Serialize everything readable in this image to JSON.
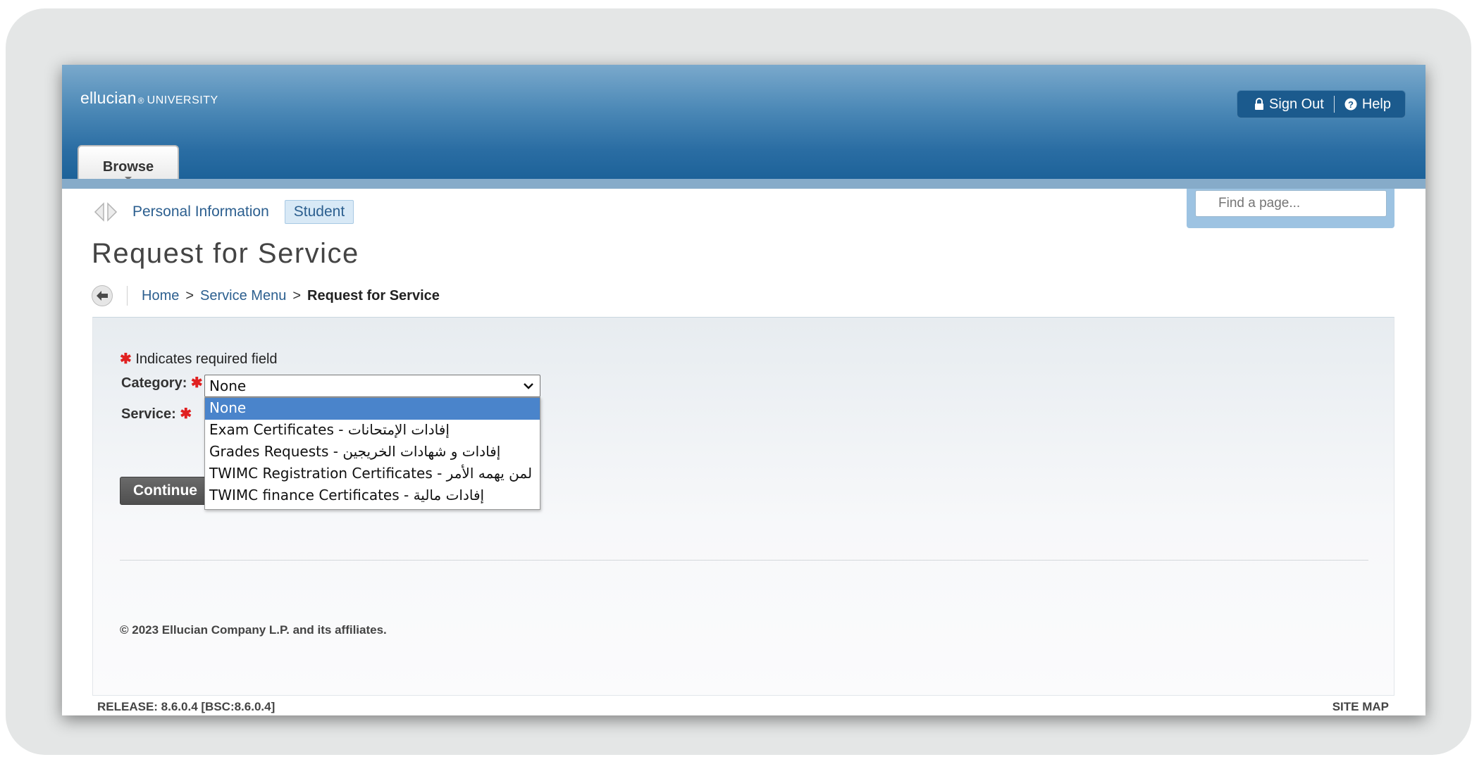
{
  "header": {
    "brand_name": "ellucian",
    "brand_mark": "®",
    "brand_university": "UNIVERSITY",
    "sign_out_label": "Sign Out",
    "help_label": "Help",
    "browse_label": "Browse",
    "find_placeholder": "Find a page..."
  },
  "nav": {
    "personal_info": "Personal Information",
    "student": "Student"
  },
  "page": {
    "title": "Request for Service"
  },
  "breadcrumb": {
    "home": "Home",
    "separator": ">",
    "service_menu": "Service Menu",
    "current": "Request for Service"
  },
  "form": {
    "required_star": "✱",
    "required_note": "Indicates required field",
    "category_label": "Category:",
    "service_label": "Service:",
    "category_value": "None",
    "category_options": [
      "None",
      "Exam Certificates - إفادات الإمتحانات",
      "Grades Requests - إفادات و شهادات الخريجين",
      "TWIMC Registration Certificates - لمن يهمه الأمر",
      "TWIMC finance Certificates - إفادات مالية"
    ],
    "selected_option_index": 0,
    "continue_label": "Continue"
  },
  "footer": {
    "copyright": "© 2023 Ellucian Company L.P. and its affiliates.",
    "release": "RELEASE: 8.6.0.4 [BSC:8.6.0.4]",
    "site_map": "SITE MAP"
  },
  "icons": {
    "lock": "lock-icon",
    "help": "help-icon",
    "search": "search-icon",
    "nav_arrows": "nav-arrows-icon",
    "back": "back-arrow-icon",
    "dropdown": "chevron-down-icon"
  },
  "colors": {
    "header_blue": "#2a6da3",
    "link_blue": "#2c5f8f",
    "selected_option": "#4a84cb",
    "required_red": "#e02020"
  }
}
